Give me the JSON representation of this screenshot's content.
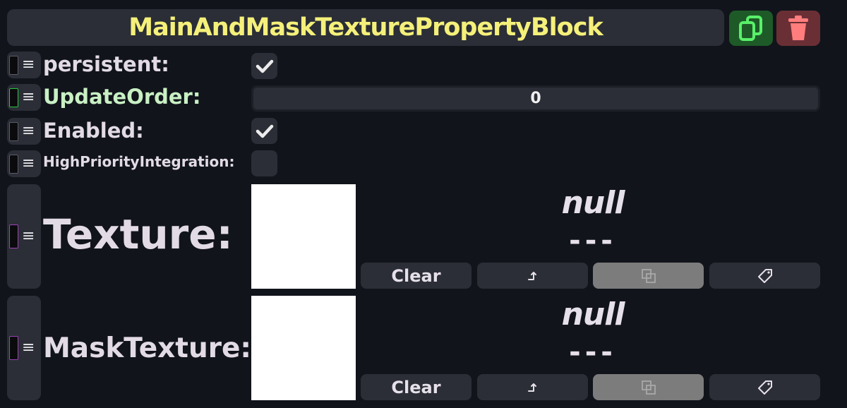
{
  "header": {
    "title": "MainAndMaskTexturePropertyBlock",
    "duplicate_icon": "duplicate-icon",
    "delete_icon": "trash-icon"
  },
  "fields": {
    "persistent": {
      "label": "persistent:",
      "checked": true
    },
    "update_order": {
      "label": "UpdateOrder:",
      "value": "0"
    },
    "enabled": {
      "label": "Enabled:",
      "checked": true
    },
    "high_priority": {
      "label": "HighPriorityIntegration:",
      "checked": false
    },
    "texture": {
      "label": "Texture:",
      "asset_name": "null",
      "asset_info": "---",
      "clear_label": "Clear",
      "buttons": [
        "Clear",
        "open-reference-icon",
        "copy-icon",
        "tag-icon"
      ]
    },
    "mask_texture": {
      "label": "MaskTexture:",
      "asset_name": "null",
      "asset_info": "---",
      "clear_label": "Clear",
      "buttons": [
        "Clear",
        "open-reference-icon",
        "copy-icon",
        "tag-icon"
      ]
    }
  },
  "colors": {
    "title": "#f5f07a",
    "update_order_label": "#c9f0c4",
    "swatch_green_border": "#28c83c",
    "swatch_purple_border": "#a040b8",
    "duplicate_button": "#1e5a28",
    "delete_button": "#6a2f35"
  }
}
